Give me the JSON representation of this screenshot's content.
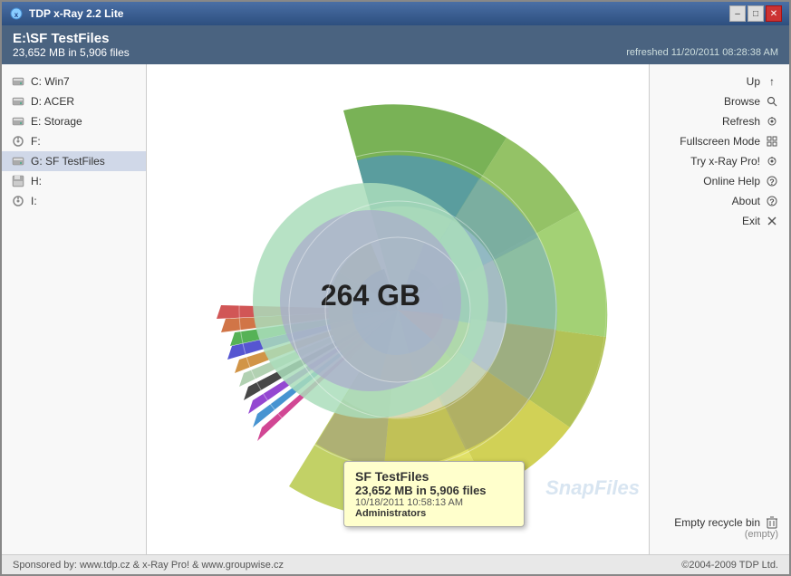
{
  "window": {
    "title": "TDP x-Ray 2.2 Lite",
    "controls": {
      "minimize": "–",
      "maximize": "□",
      "close": "✕"
    }
  },
  "header": {
    "path": "E:\\SF TestFiles",
    "size_info": "23,652 MB in 5,906 files",
    "refreshed": "refreshed 11/20/2011 08:28:38 AM"
  },
  "drives": [
    {
      "id": "c",
      "label": "C: Win7",
      "icon": "hdd"
    },
    {
      "id": "d",
      "label": "D: ACER",
      "icon": "hdd"
    },
    {
      "id": "e",
      "label": "E: Storage",
      "icon": "hdd"
    },
    {
      "id": "f",
      "label": "F:",
      "icon": "removable"
    },
    {
      "id": "g",
      "label": "G: SF TestFiles",
      "icon": "hdd",
      "selected": true
    },
    {
      "id": "h",
      "label": "H:",
      "icon": "save"
    },
    {
      "id": "i",
      "label": "I:",
      "icon": "removable"
    }
  ],
  "chart": {
    "center_label": "264 GB"
  },
  "nav": [
    {
      "id": "up",
      "label": "Up",
      "icon": "↑"
    },
    {
      "id": "browse",
      "label": "Browse",
      "icon": "🔍"
    },
    {
      "id": "refresh",
      "label": "Refresh",
      "icon": "☢"
    },
    {
      "id": "fullscreen",
      "label": "Fullscreen Mode",
      "icon": "⊞"
    },
    {
      "id": "xraypro",
      "label": "Try x-Ray Pro!",
      "icon": "☢"
    },
    {
      "id": "help",
      "label": "Online Help",
      "icon": "?"
    },
    {
      "id": "about",
      "label": "About",
      "icon": "?"
    },
    {
      "id": "exit",
      "label": "Exit",
      "icon": "⊠"
    }
  ],
  "recycle": {
    "label": "Empty recycle bin",
    "status": "(empty)"
  },
  "tooltip": {
    "title": "SF TestFiles",
    "size": "23,652 MB in 5,906 files",
    "date": "10/18/2011 10:58:13 AM",
    "owner": "Administrators"
  },
  "footer": {
    "sponsor": "Sponsored by: www.tdp.cz & x-Ray Pro! & www.groupwise.cz",
    "copyright": "©2004-2009 TDP Ltd."
  },
  "watermark": "SnapFiles"
}
